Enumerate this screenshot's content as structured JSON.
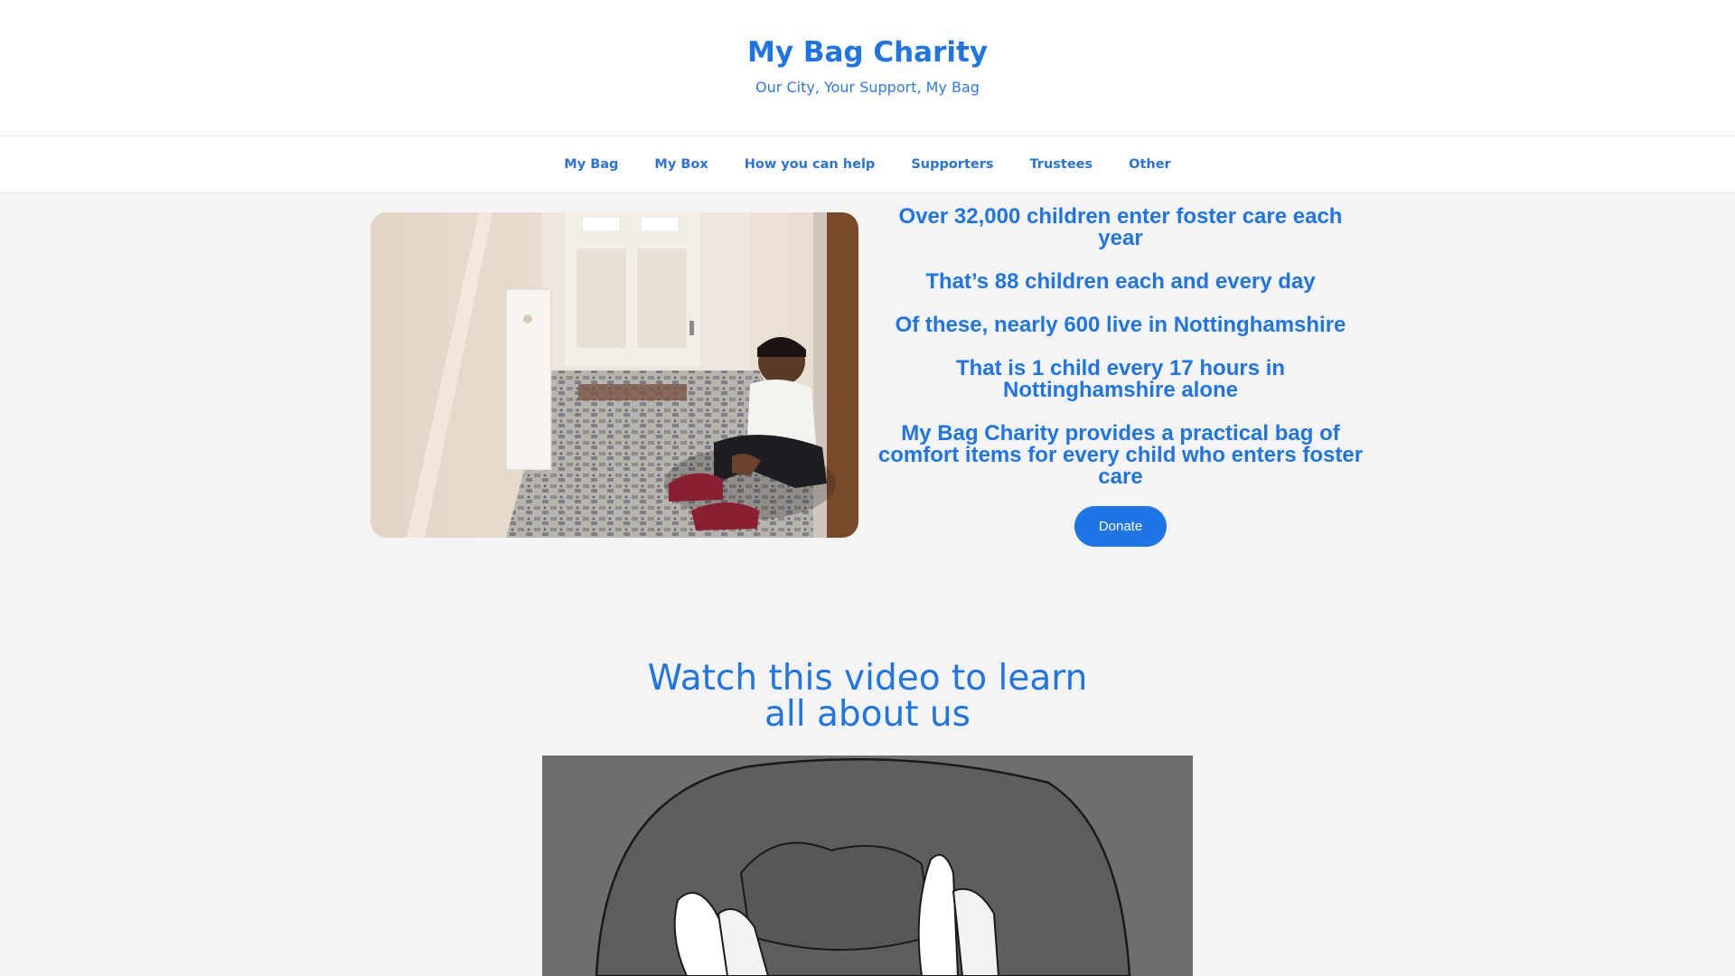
{
  "header": {
    "site_title": "My Bag Charity",
    "tagline": "Our City, Your Support, My Bag"
  },
  "nav": {
    "items": [
      "My Bag",
      "My Box",
      "How you can help",
      "Supporters",
      "Trustees",
      "Other"
    ]
  },
  "hero": {
    "image_subject": "boy-sitting-in-hallway-photo",
    "stats": [
      "Over 32,000 children enter foster care each year",
      "That’s 88 children each and every day",
      "Of these, nearly 600 live in Nottinghamshire",
      "That is 1 child every 17 hours in Nottinghamshire alone",
      "My Bag Charity provides a practical bag of comfort items for every child who enters foster care"
    ],
    "donate_label": "Donate"
  },
  "video_section": {
    "heading_line1": "Watch this video to learn",
    "heading_line2": "all about us",
    "thumbnail_subject": "illustrated-hands-holding-bag"
  },
  "colors": {
    "accent": "#1f74e6",
    "page_background": "#f4f4f4",
    "header_background": "#ffffff"
  }
}
